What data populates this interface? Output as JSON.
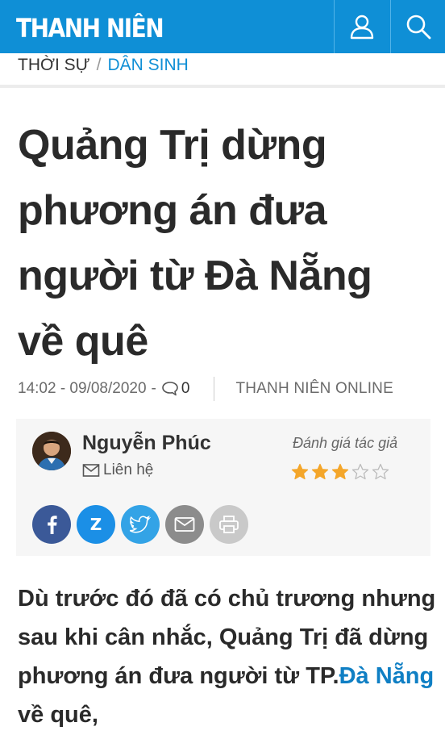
{
  "header": {
    "logo": "THANH NIÊN",
    "user_icon": "user-icon",
    "search_icon": "search-icon",
    "background": "#0f8fd6"
  },
  "breadcrumb": {
    "section": "THỜI SỰ",
    "separator": "/",
    "subsection": "DÂN SINH"
  },
  "article": {
    "title_lines": [
      "Quảng Trị dừng",
      "phương án đưa",
      "người từ Đà Nẵng",
      "về quê"
    ],
    "time": "14:02 - 09/08/2020",
    "dash": "-",
    "comment_count": "0",
    "source": "THANH NIÊN ONLINE",
    "lead_text": "Dù trước đó đã có chủ trương nhưng sau khi cân nhắc, Quảng Trị đã dừng phương án đưa người từ TP.",
    "lead_link": "Đà Nẵng",
    "lead_tail": " về quê,"
  },
  "author": {
    "name": "Nguyễn Phúc",
    "contact_label": "Liên hệ",
    "rating_label": "Đánh giá tác giả",
    "rating": 3,
    "rating_max": 5,
    "star_color": "#f4a62a"
  },
  "share": {
    "buttons": [
      "facebook-icon",
      "zalo-icon",
      "twitter-icon",
      "mail-icon",
      "print-icon"
    ],
    "zalo_glyph": "Z"
  }
}
